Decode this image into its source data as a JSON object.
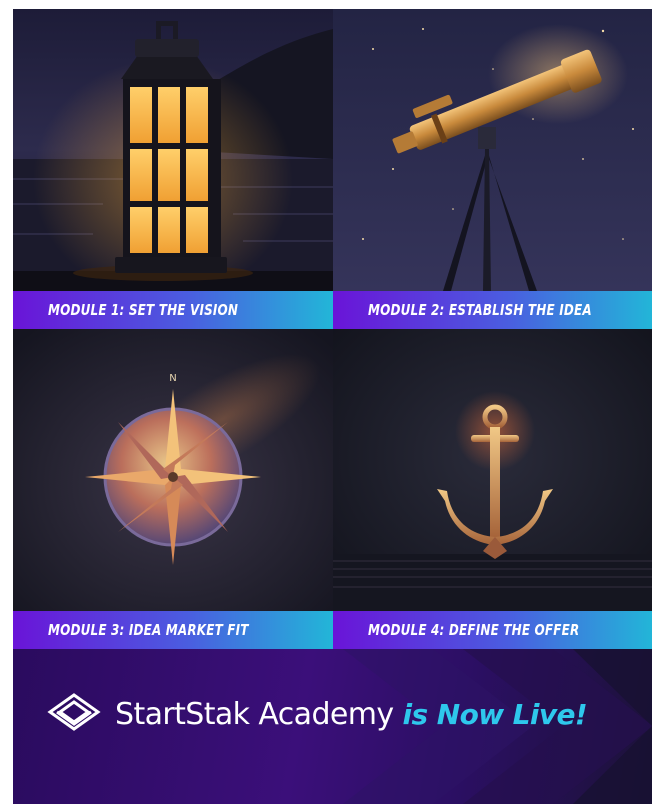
{
  "modules": [
    {
      "label": "MODULE 1: SET THE VISION",
      "image": "lantern-illustration"
    },
    {
      "label": "MODULE 2: ESTABLISH THE IDEA",
      "image": "telescope-illustration"
    },
    {
      "label": "MODULE 3: IDEA MARKET FIT",
      "image": "compass-illustration"
    },
    {
      "label": "MODULE 4: DEFINE THE OFFER",
      "image": "anchor-illustration"
    }
  ],
  "compass": {
    "north_label": "N"
  },
  "banner": {
    "brand_name": "StartStak Academy",
    "tagline": "is Now Live!",
    "logo_icon": "diamond-stack-icon"
  },
  "colors": {
    "caption_start": "#6a14d8",
    "caption_end": "#22b6d8",
    "banner_bg": "#2a0b5e",
    "tagline": "#2ec8ec"
  }
}
